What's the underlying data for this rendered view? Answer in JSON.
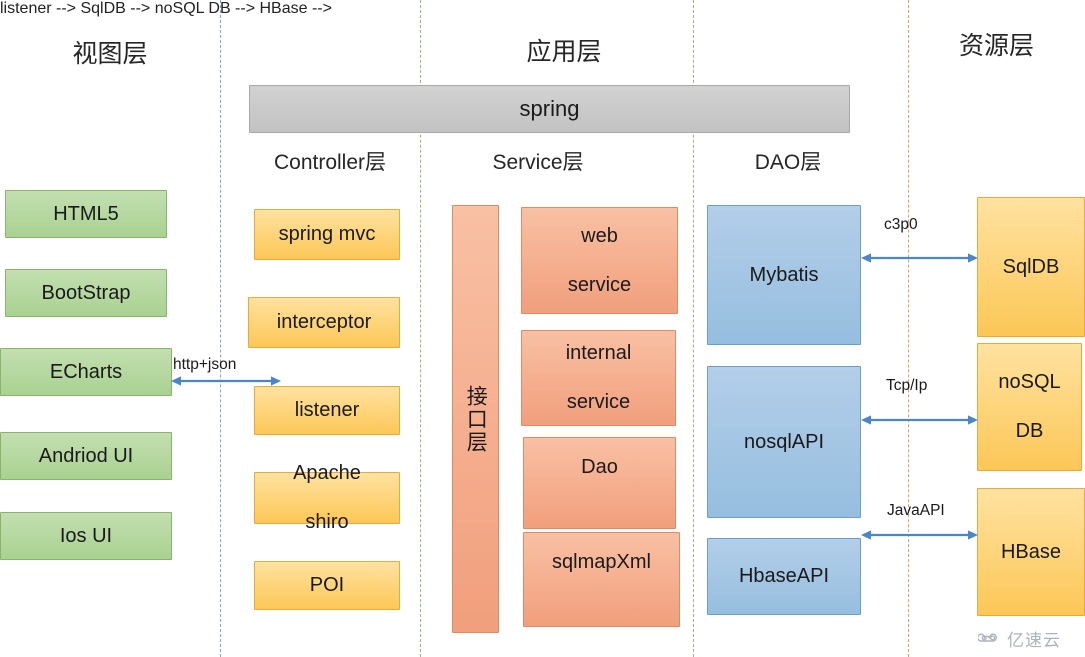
{
  "columns": {
    "view_layer_title": "视图层",
    "app_layer_title": "应用层",
    "resource_layer_title": "资源层"
  },
  "sub_titles": {
    "controller": "Controller层",
    "service": "Service层",
    "dao": "DAO层"
  },
  "framework_bar": {
    "label": "spring"
  },
  "view_layer": {
    "items": [
      {
        "label": "HTML5"
      },
      {
        "label": "BootStrap"
      },
      {
        "label": "ECharts"
      },
      {
        "label": "Andriod  UI"
      },
      {
        "label": "Ios  UI"
      }
    ]
  },
  "controller_layer": {
    "items": [
      {
        "label": "spring mvc"
      },
      {
        "label": "interceptor"
      },
      {
        "label": "listener"
      },
      {
        "label": "Apache shiro",
        "line1": "Apache",
        "line2": "shiro"
      },
      {
        "label": "POI"
      }
    ]
  },
  "service_layer": {
    "interface_bar": "接口层",
    "items": [
      {
        "label": "web service",
        "line1": "web",
        "line2": "service"
      },
      {
        "label": "internal service",
        "line1": "internal",
        "line2": "service"
      },
      {
        "label": "Dao"
      },
      {
        "label": "sqlmapXml"
      }
    ]
  },
  "dao_layer": {
    "items": [
      {
        "label": "Mybatis"
      },
      {
        "label": "nosqlAPI"
      },
      {
        "label": "HbaseAPI"
      }
    ]
  },
  "resource_layer": {
    "items": [
      {
        "label": "SqlDB"
      },
      {
        "label": "noSQL DB",
        "line1": "noSQL",
        "line2": "DB"
      },
      {
        "label": "HBase"
      }
    ]
  },
  "connections": [
    {
      "label": "http+json"
    },
    {
      "label": "c3p0"
    },
    {
      "label": "Tcp/Ip"
    },
    {
      "label": "JavaAPI"
    }
  ],
  "watermark": {
    "text": "亿速云"
  },
  "colors": {
    "view_node": "#a9d191",
    "controller_node": "#fcc757",
    "service_node": "#f19f7c",
    "dao_node": "#96bedf",
    "resource_node": "#fcc757",
    "framework_bar": "#c2c2c2",
    "arrow": "#4a86c8",
    "divider_view": "#8fa3bf",
    "divider_app": "#9bbb7a",
    "divider_resource": "#e0a06a"
  }
}
